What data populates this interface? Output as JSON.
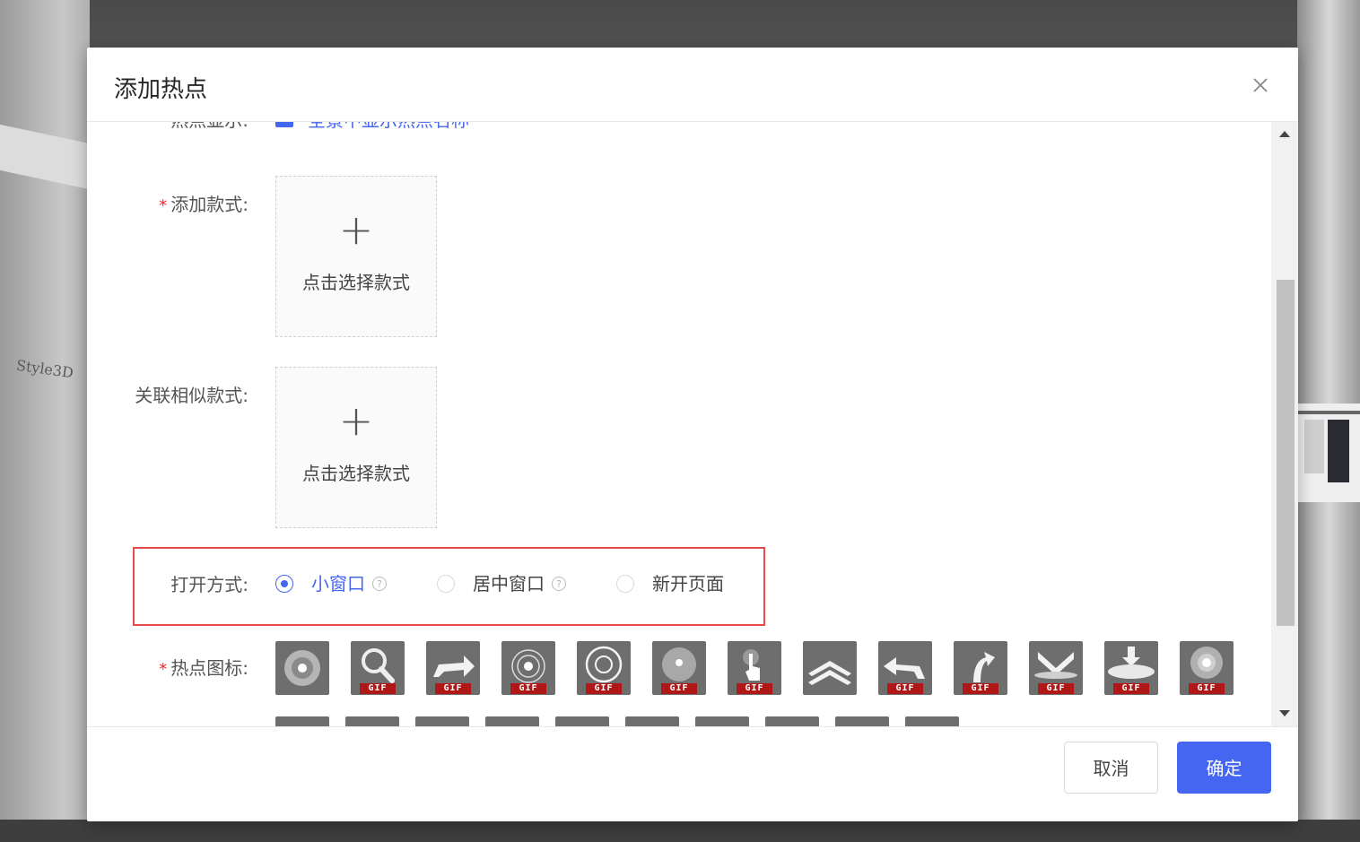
{
  "background": {
    "logo_text": "Style3D"
  },
  "dialog": {
    "title": "添加热点",
    "close_icon": "close-icon"
  },
  "form": {
    "display_row": {
      "label": "热点显示:",
      "checkbox_text": "全景中显示热点名称",
      "checked": true
    },
    "add_style": {
      "required": true,
      "label": "添加款式:",
      "plus": "+",
      "upload_text": "点击选择款式"
    },
    "related_style": {
      "label": "关联相似款式:",
      "plus": "+",
      "upload_text": "点击选择款式"
    },
    "open_mode": {
      "label": "打开方式:",
      "options": [
        {
          "label": "小窗口",
          "checked": true,
          "help": "?"
        },
        {
          "label": "居中窗口",
          "checked": false,
          "help": "?"
        },
        {
          "label": "新开页面",
          "checked": false
        }
      ]
    },
    "hotspot_icon": {
      "required": true,
      "label": "热点图标:",
      "gif_tag": "GIF",
      "icons": [
        {
          "name": "target-dot-icon",
          "gif": false
        },
        {
          "name": "magnifier-icon",
          "gif": true
        },
        {
          "name": "arrow-turn-right-icon",
          "gif": true
        },
        {
          "name": "ripple-circle-icon",
          "gif": true
        },
        {
          "name": "ring-icon",
          "gif": true
        },
        {
          "name": "disc-dot-icon",
          "gif": true
        },
        {
          "name": "pointer-hand-icon",
          "gif": true
        },
        {
          "name": "double-chevron-up-icon",
          "gif": false
        },
        {
          "name": "arrow-turn-left-icon",
          "gif": true
        },
        {
          "name": "curve-arrow-up-icon",
          "gif": true
        },
        {
          "name": "chevron-down-platform-icon",
          "gif": true
        },
        {
          "name": "arrow-down-platform-icon",
          "gif": true
        },
        {
          "name": "glow-dot-icon",
          "gif": true
        }
      ]
    }
  },
  "footer": {
    "cancel_label": "取消",
    "ok_label": "确定"
  },
  "colors": {
    "primary": "#4466f0",
    "required": "#f5222d",
    "highlight_border": "#e84a4a",
    "icon_bg": "#6e6e6e",
    "gif_tag": "#b01818"
  }
}
